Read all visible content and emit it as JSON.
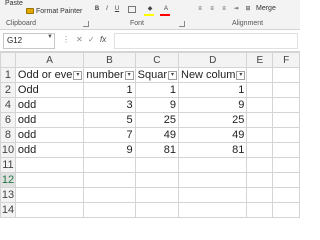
{
  "ribbon": {
    "paste_label": "Paste",
    "format_painter_label": "Format Painter",
    "merge_label": "Merge",
    "groups": {
      "clipboard": "Clipboard",
      "font": "Font",
      "alignment": "Alignment"
    },
    "icons": {
      "bold": "B",
      "italic": "I",
      "underline": "U",
      "fill": "◆",
      "font_color": "A",
      "align_left": "≡",
      "align_center": "≡",
      "align_right": "≡",
      "indent": "⇥",
      "merge": "⊞"
    },
    "colors": {
      "fill": "#ffff00",
      "font_color": "#ff0000"
    }
  },
  "formula_bar": {
    "name_box": "G12",
    "dots": "⋮",
    "cancel": "✕",
    "enter": "✓",
    "fx": "fx",
    "value": ""
  },
  "sheet": {
    "columns": [
      "A",
      "B",
      "C",
      "D",
      "E",
      "F"
    ],
    "rows": [
      {
        "num": "1",
        "cells": [
          "Odd or eve",
          "number",
          "Squar",
          "New colum",
          "",
          ""
        ]
      },
      {
        "num": "2",
        "cells": [
          "Odd",
          "1",
          "1",
          "1",
          "",
          ""
        ]
      },
      {
        "num": "4",
        "cells": [
          "odd",
          "3",
          "9",
          "9",
          "",
          ""
        ]
      },
      {
        "num": "6",
        "cells": [
          "odd",
          "5",
          "25",
          "25",
          "",
          ""
        ]
      },
      {
        "num": "8",
        "cells": [
          "odd",
          "7",
          "49",
          "49",
          "",
          ""
        ]
      },
      {
        "num": "10",
        "cells": [
          "odd",
          "9",
          "81",
          "81",
          "",
          ""
        ]
      },
      {
        "num": "11",
        "cells": [
          "",
          "",
          "",
          "",
          "",
          ""
        ]
      },
      {
        "num": "12",
        "cells": [
          "",
          "",
          "",
          "",
          "",
          ""
        ]
      },
      {
        "num": "13",
        "cells": [
          "",
          "",
          "",
          "",
          "",
          ""
        ]
      },
      {
        "num": "14",
        "cells": [
          "",
          "",
          "",
          "",
          "",
          ""
        ]
      }
    ],
    "filter_icon": "▾",
    "selected_row_color": "#217346"
  }
}
